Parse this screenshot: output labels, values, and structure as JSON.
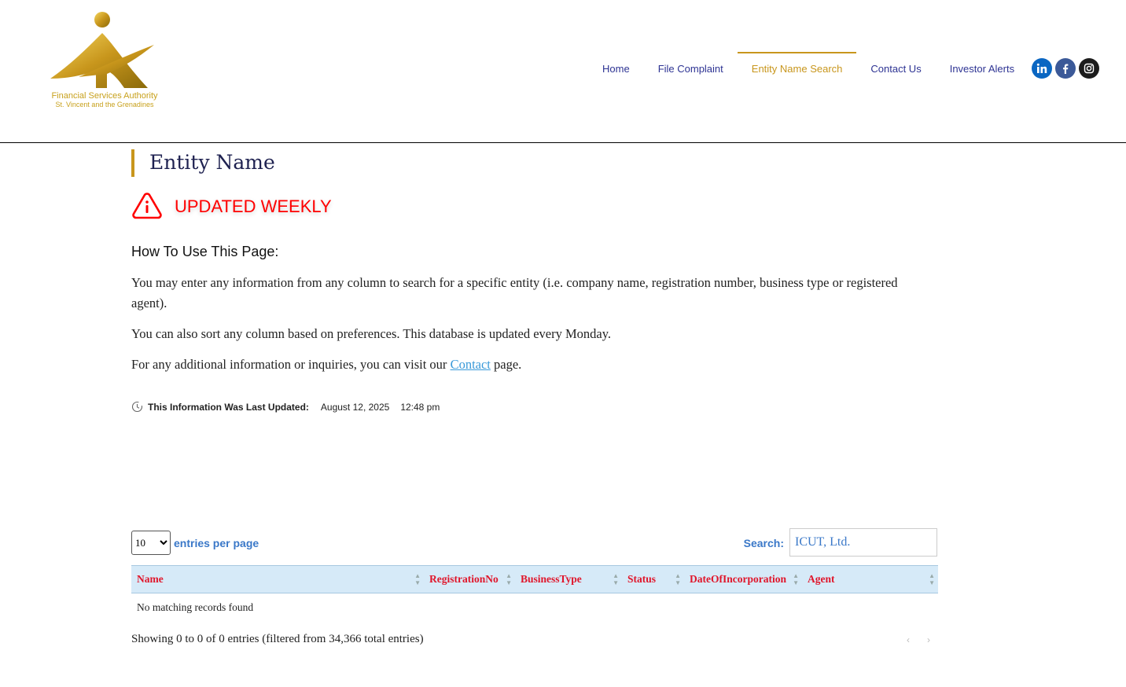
{
  "logo": {
    "line1": "Financial Services Authority",
    "line2": "St. Vincent and the Grenadines",
    "icon": "fsa-logo-icon"
  },
  "nav": {
    "items": [
      {
        "label": "Home",
        "active": false
      },
      {
        "label": "File Complaint",
        "active": false
      },
      {
        "label": "Entity Name Search",
        "active": true
      },
      {
        "label": "Contact Us",
        "active": false
      },
      {
        "label": "Investor Alerts",
        "active": false
      }
    ]
  },
  "social": [
    "linkedin-icon",
    "facebook-icon",
    "instagram-icon"
  ],
  "page": {
    "title": "Entity Name",
    "notice": "UPDATED WEEKLY",
    "howto_heading": "How To Use This Page:",
    "para1": "You may enter any information from any column to search for a specific entity (i.e. company name, registration number, business type or registered agent).",
    "para2": "You can also sort any column based on preferences. This database is updated every Monday.",
    "para3_before": "For any additional information or inquiries, you can visit our ",
    "para3_link": "Contact",
    "para3_after": " page.",
    "updated_label": "This Information Was Last Updated:",
    "updated_date": "August 12, 2025",
    "updated_time": "12:48 pm"
  },
  "table_controls": {
    "page_length": "10",
    "page_length_label": "entries per page",
    "search_label": "Search:",
    "search_value": "ICUT, Ltd."
  },
  "table": {
    "columns": [
      "Name",
      "RegistrationNo",
      "BusinessType",
      "Status",
      "DateOfIncorporation",
      "Agent"
    ],
    "empty_message": "No matching records found",
    "info": "Showing 0 to 0 of 0 entries (filtered from 34,366 total entries)"
  },
  "pager": {
    "prev": "‹",
    "next": "›"
  },
  "colors": {
    "gold": "#c8961c",
    "navy": "#2d3393",
    "red": "#ff0000",
    "header_red": "#e0162b",
    "table_header_bg": "#d6eaf8"
  }
}
